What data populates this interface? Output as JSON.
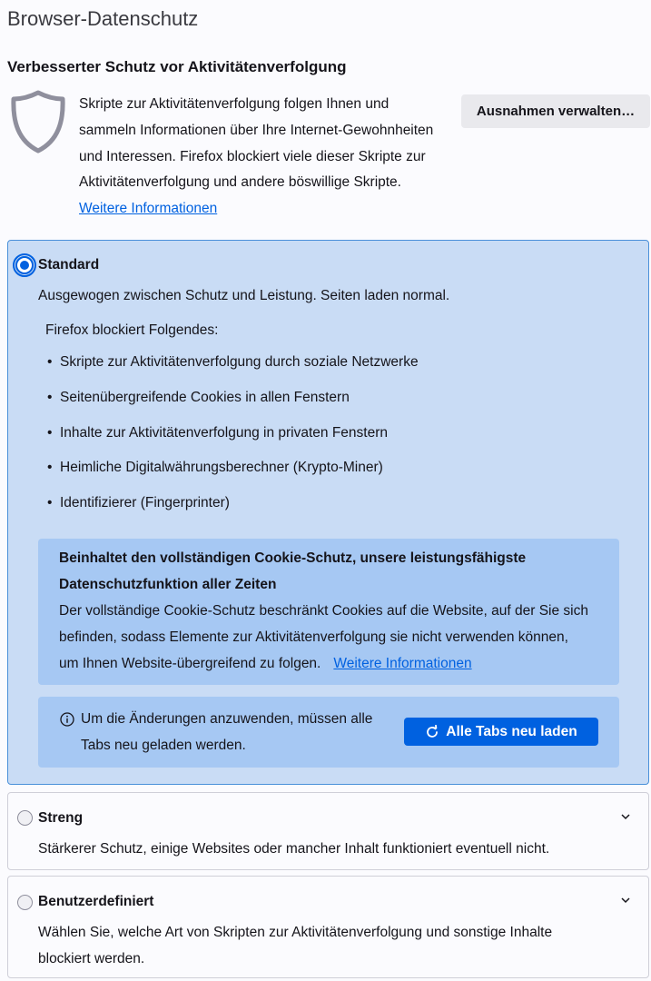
{
  "page": {
    "title": "Browser-Datenschutz"
  },
  "etp": {
    "heading": "Verbesserter Schutz vor Aktivitätenverfolgung",
    "intro_lines": [
      "Skripte zur Aktivitätenverfolgung folgen Ihnen und",
      "sammeln Informationen über Ihre Internet-Gewohnheiten",
      "und Interessen. Firefox blockiert viele dieser Skripte zur",
      "Aktivitätenverfolgung und andere böswillige Skripte."
    ],
    "learn_more": "Weitere Informationen",
    "exceptions_button": "Ausnahmen verwalten…",
    "icon": "shield-icon"
  },
  "standard": {
    "label": "Standard",
    "selected": true,
    "description": "Ausgewogen zwischen Schutz und Leistung. Seiten laden normal.",
    "blocks_heading": "Firefox blockiert Folgendes:",
    "blocks": [
      "Skripte zur Aktivitätenverfolgung durch soziale Netzwerke",
      "Seitenübergreifende Cookies in allen Fenstern",
      "Inhalte zur Aktivitätenverfolgung in privaten Fenstern",
      "Heimliche Digitalwährungsberechner (Krypto-Miner)",
      "Identifizierer (Fingerprinter)"
    ],
    "tcp": {
      "title_lines": [
        "Beinhaltet den vollständigen Cookie-Schutz, unsere leistungsfähigste",
        "Datenschutzfunktion aller Zeiten"
      ],
      "body_lines": [
        "Der vollständige Cookie-Schutz beschränkt Cookies auf die Website, auf der Sie sich",
        "befinden, sodass Elemente zur Aktivitätenverfolgung sie nicht verwenden können,",
        "um Ihnen Website-übergreifend zu folgen."
      ],
      "learn_more": "Weitere Informationen"
    },
    "reload": {
      "text_lines": [
        "Um die Änderungen anzuwenden, müssen alle",
        "Tabs neu geladen werden."
      ],
      "button": "Alle Tabs neu laden"
    }
  },
  "strict": {
    "label": "Streng",
    "selected": false,
    "description": "Stärkerer Schutz, einige Websites oder mancher Inhalt funktioniert eventuell nicht."
  },
  "custom": {
    "label": "Benutzerdefiniert",
    "selected": false,
    "description_lines": [
      "Wählen Sie, welche Art von Skripten zur Aktivitätenverfolgung und sonstige Inhalte",
      "blockiert werden."
    ]
  },
  "colors": {
    "accent": "#0061e0",
    "selected_bg": "#c9dcf5",
    "inner_box": "#a6c8f3"
  }
}
